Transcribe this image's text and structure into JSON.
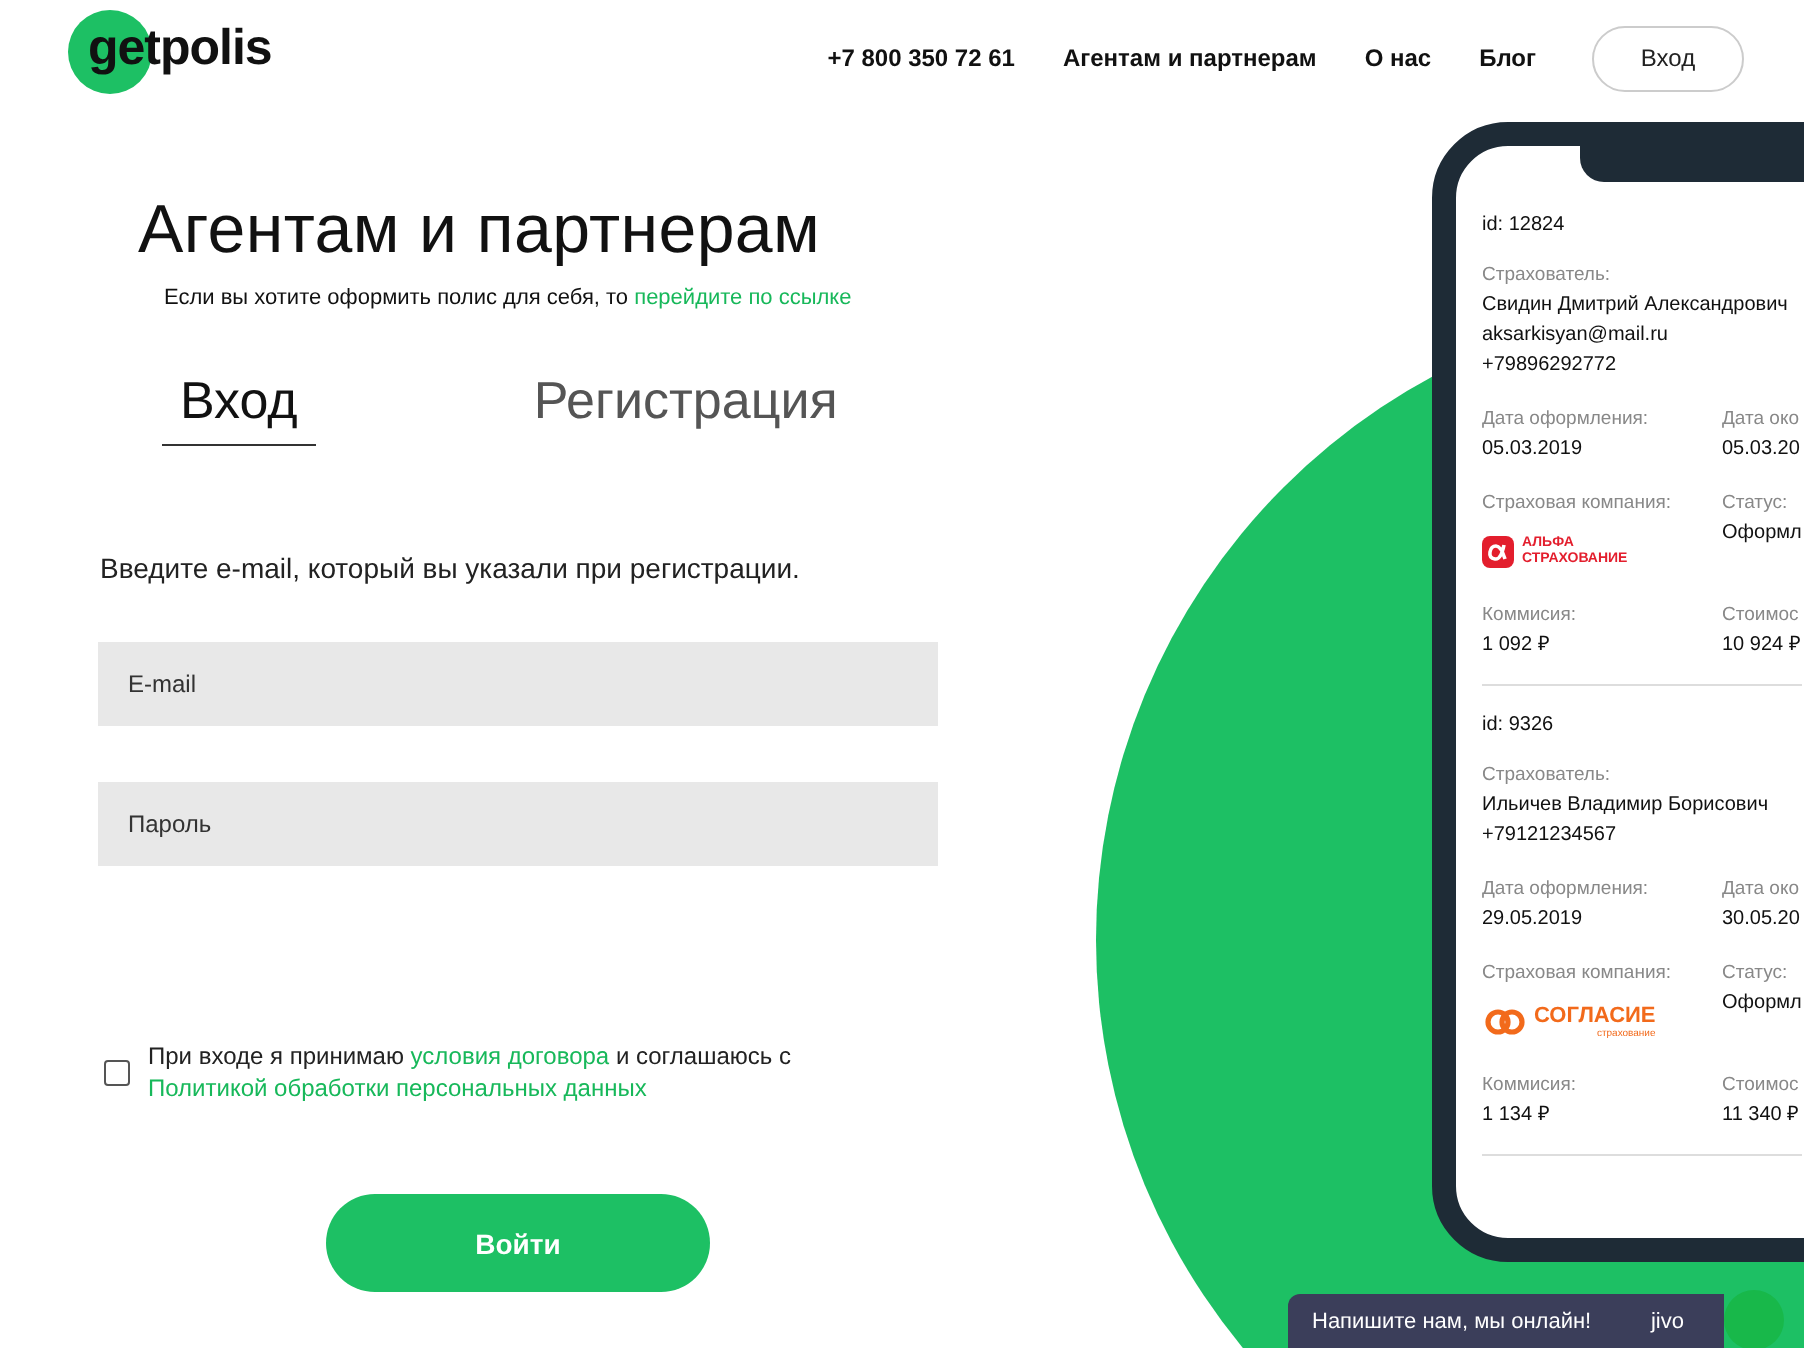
{
  "header": {
    "logo": "getpolis",
    "nav": [
      {
        "label": "+7 800 350 72 61"
      },
      {
        "label": "Агентам и партнерам"
      },
      {
        "label": "О нас"
      },
      {
        "label": "Блог"
      }
    ],
    "login_button": "Вход"
  },
  "form": {
    "title": "Агентам и партнерам",
    "subtitle": "Если вы хотите оформить полис для себя, то",
    "subtitle_link": "перейдите по ссылке",
    "tabs": [
      {
        "label": "Вход",
        "selected": true
      },
      {
        "label": "Регистрация",
        "selected": false
      }
    ],
    "instruction": "Введите e-mail, который вы указали при регистрации.",
    "fields": [
      {
        "placeholder": "E-mail"
      },
      {
        "placeholder": "Пароль"
      }
    ],
    "consent": {
      "checked": false,
      "text_1": "При входе я принимаю",
      "link_1": "условия договора",
      "text_2": "и соглашаюсь с",
      "link_2": "Политикой обработки персональных данных"
    },
    "submit": "Войти"
  },
  "phone_preview": {
    "policies": [
      {
        "id": "id: 12824",
        "holder_label": "Страхователь:",
        "holder_lines": [
          "Свидин Дмитрий Александрович",
          "aksarkisyan@mail.ru",
          "+79896292772"
        ],
        "rows": [
          [
            {
              "kind": "text",
              "label": "Дата оформления:",
              "value": "05.03.2019"
            },
            {
              "kind": "text",
              "label": "Дата око",
              "value": "05.03.20"
            }
          ],
          [
            {
              "kind": "alfa",
              "label": "Страховая компания:",
              "logo_lines": [
                "АЛЬФА",
                "СТРАХОВАНИЕ"
              ]
            },
            {
              "kind": "text",
              "label": "Статус:",
              "value": "Оформл"
            }
          ],
          [
            {
              "kind": "text",
              "label": "Коммисия:",
              "value": "1 092 ₽"
            },
            {
              "kind": "text",
              "label": "Стоимос",
              "value": "10 924 ₽"
            }
          ]
        ]
      },
      {
        "id": "id: 9326",
        "holder_label": "Страхователь:",
        "holder_lines": [
          "Ильичев Владимир Борисович",
          "+79121234567"
        ],
        "rows": [
          [
            {
              "kind": "text",
              "label": "Дата оформления:",
              "value": "29.05.2019"
            },
            {
              "kind": "text",
              "label": "Дата око",
              "value": "30.05.20"
            }
          ],
          [
            {
              "kind": "soglasie",
              "label": "Страховая компания:",
              "logo_lines": [
                "СОГЛАСИЕ",
                "страхование"
              ]
            },
            {
              "kind": "text",
              "label": "Статус:",
              "value": "Оформл"
            }
          ],
          [
            {
              "kind": "text",
              "label": "Коммисия:",
              "value": "1 134 ₽"
            },
            {
              "kind": "text",
              "label": "Стоимос",
              "value": "11 340 ₽"
            }
          ]
        ]
      }
    ]
  },
  "chat_widget": {
    "text": "Напишите нам, мы онлайн!",
    "brand": "jivo"
  }
}
